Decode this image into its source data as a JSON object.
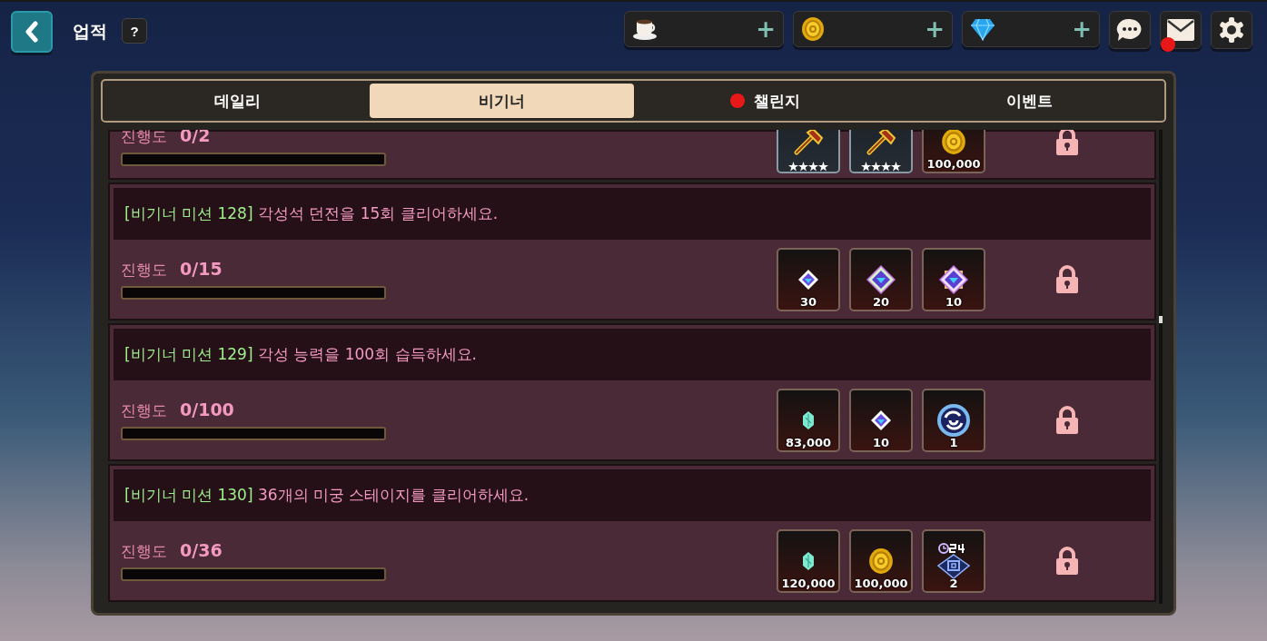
{
  "header": {
    "title": "업적",
    "help": "?"
  },
  "currencies": [
    {
      "kind": "cup",
      "plus": "+"
    },
    {
      "kind": "coin",
      "plus": "+"
    },
    {
      "kind": "diamond",
      "plus": "+"
    }
  ],
  "actions": [
    {
      "kind": "chat",
      "alert": false
    },
    {
      "kind": "mail",
      "alert": true
    },
    {
      "kind": "settings",
      "alert": false
    }
  ],
  "tabs": [
    {
      "label": "데일리",
      "selected": false,
      "alert": false
    },
    {
      "label": "비기너",
      "selected": true,
      "alert": false
    },
    {
      "label": "챌린지",
      "selected": false,
      "alert": true
    },
    {
      "label": "이벤트",
      "selected": false,
      "alert": false
    }
  ],
  "missions": [
    {
      "progress_label": "진행도",
      "progress": "0/2",
      "level": 0,
      "locked": true,
      "rewards": [
        {
          "kind": "hammer",
          "stars": 4
        },
        {
          "kind": "hammer",
          "stars": 4
        },
        {
          "kind": "coin",
          "amount": "100,000"
        }
      ]
    },
    {
      "tag": "[비기너 미션 128]",
      "text": "각성석 던전을 15회 클리어하세요.",
      "progress_label": "진행도",
      "progress": "0/15",
      "level": 0,
      "locked": true,
      "rewards": [
        {
          "kind": "gem-small",
          "amount": "30"
        },
        {
          "kind": "gem-medium",
          "amount": "20"
        },
        {
          "kind": "gem-large",
          "amount": "10"
        }
      ]
    },
    {
      "tag": "[비기너 미션 129]",
      "text": "각성 능력을 100회 습득하세요.",
      "progress_label": "진행도",
      "progress": "0/100",
      "level": 0,
      "locked": true,
      "rewards": [
        {
          "kind": "crystal",
          "amount": "83,000"
        },
        {
          "kind": "gem-small",
          "amount": "10"
        },
        {
          "kind": "orb",
          "amount": "1"
        }
      ]
    },
    {
      "tag": "[비기너 미션 130]",
      "text": "36개의 미궁 스테이지를 클리어하세요.",
      "progress_label": "진행도",
      "progress": "0/36",
      "level": 0,
      "locked": true,
      "rewards": [
        {
          "kind": "crystal",
          "amount": "120,000"
        },
        {
          "kind": "coin",
          "amount": "100,000"
        },
        {
          "kind": "ticket",
          "amount": "2"
        }
      ]
    }
  ]
}
